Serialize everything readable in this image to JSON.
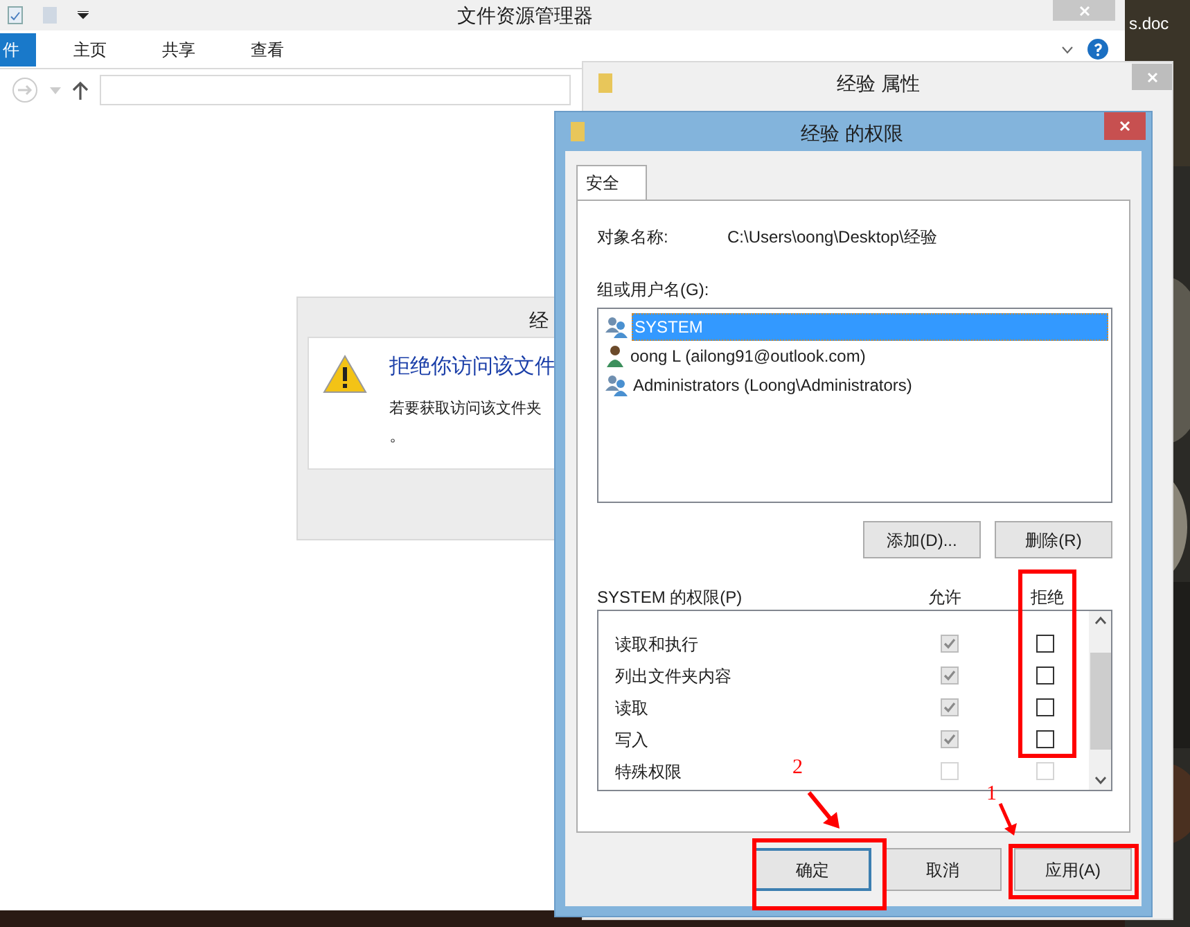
{
  "explorer": {
    "title": "文件资源管理器",
    "ribbon_tabs": [
      {
        "label": "件",
        "selected": true
      },
      {
        "label": "主页",
        "selected": false
      },
      {
        "label": "共享",
        "selected": false
      },
      {
        "label": "查看",
        "selected": false
      }
    ]
  },
  "desktop": {
    "file_label": "s.doc"
  },
  "access_denied": {
    "title": "经",
    "heading": "拒绝你访问该文件",
    "message": "若要获取访问该文件夹",
    "message_end": "。"
  },
  "properties": {
    "title": "经验 属性"
  },
  "permissions": {
    "title": "经验 的权限",
    "tabs": [
      {
        "label": "安全",
        "selected": true
      }
    ],
    "object_label": "对象名称:",
    "object_value": "C:\\Users\\oong\\Desktop\\经验",
    "group_label": "组或用户名(G):",
    "users": [
      {
        "name": "SYSTEM",
        "kind": "group",
        "selected": true
      },
      {
        "name": "oong L (ailong91@outlook.com)",
        "kind": "user",
        "selected": false
      },
      {
        "name": "Administrators (Loong\\Administrators)",
        "kind": "group",
        "selected": false
      }
    ],
    "user_buttons": [
      "添加(D)...",
      "删除(R)"
    ],
    "perm_label": "SYSTEM 的权限(P)",
    "allow_header": "允许",
    "deny_header": "拒绝",
    "rows": [
      {
        "name": "读取和执行",
        "allow": true,
        "deny": false,
        "disabled": false
      },
      {
        "name": "列出文件夹内容",
        "allow": true,
        "deny": false,
        "disabled": false
      },
      {
        "name": "读取",
        "allow": true,
        "deny": false,
        "disabled": false
      },
      {
        "name": "写入",
        "allow": true,
        "deny": false,
        "disabled": false
      },
      {
        "name": "特殊权限",
        "allow": false,
        "deny": false,
        "disabled": true
      }
    ],
    "buttons": [
      {
        "label": "确定",
        "kind": "default"
      },
      {
        "label": "取消",
        "kind": "normal"
      },
      {
        "label": "应用(A)",
        "kind": "normal"
      }
    ]
  },
  "annotations": [
    {
      "label": "1"
    },
    {
      "label": "2"
    }
  ]
}
